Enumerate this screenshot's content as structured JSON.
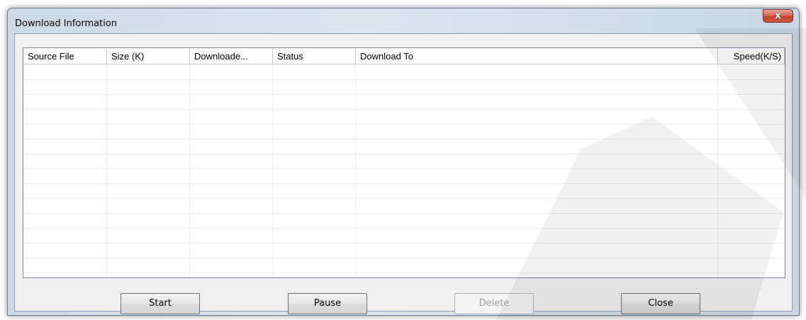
{
  "window": {
    "title": "Download Information",
    "close_glyph": "x"
  },
  "table": {
    "columns": [
      "Source File",
      "Size (K)",
      "Downloade...",
      "Status",
      "Download To",
      "Speed(K/S)"
    ],
    "rows": []
  },
  "buttons": {
    "start": "Start",
    "pause": "Pause",
    "delete": "Delete",
    "close": "Close"
  },
  "colors": {
    "close_button": "#c0452f",
    "watermark": "#000000"
  }
}
